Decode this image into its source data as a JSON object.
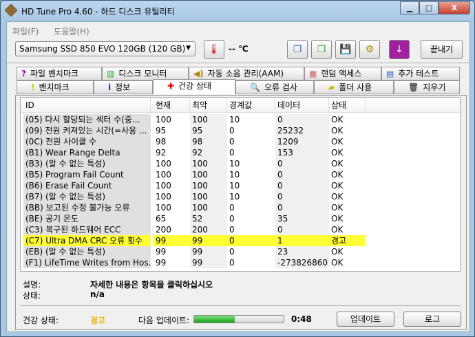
{
  "window": {
    "title": "HD Tune Pro 4.60 - 하드 디스크 유틸리티",
    "min": "▁",
    "max": "□",
    "close": "X"
  },
  "menu": [
    "파일(F)",
    "도움말(H)"
  ],
  "toolbar": {
    "drive": "Samsung SSD 850 EVO 120GB (120 GB)",
    "temperature": "-- ℃",
    "exit": "끝내기"
  },
  "tabs_row1": [
    "파일 벤치마크",
    "디스크 모니터",
    "자동 소음 관리(AAM)",
    "랜덤 액세스",
    "추가 테스트"
  ],
  "tabs_row2": [
    "벤치마크",
    "정보",
    "건강 상태",
    "오류 검사",
    "폴더 사용",
    "지우기"
  ],
  "table": {
    "headers": [
      "ID",
      "현재",
      "최악",
      "경계값",
      "데이터",
      "상태"
    ],
    "rows": [
      [
        "(05) 다시 할당되는 섹터 수(중...",
        "100",
        "100",
        "10",
        "0",
        "OK"
      ],
      [
        "(09) 전원 켜져있는 시간(=사용 ...",
        "95",
        "95",
        "0",
        "25232",
        "OK"
      ],
      [
        "(0C) 전원 사이클 수",
        "98",
        "98",
        "0",
        "1209",
        "OK"
      ],
      [
        "(B1) Wear Range Delta",
        "92",
        "92",
        "0",
        "153",
        "OK"
      ],
      [
        "(B3) (알 수 없는 특성)",
        "100",
        "100",
        "10",
        "0",
        "OK"
      ],
      [
        "(B5) Program Fail Count",
        "100",
        "100",
        "10",
        "0",
        "OK"
      ],
      [
        "(B6) Erase Fail Count",
        "100",
        "100",
        "10",
        "0",
        "OK"
      ],
      [
        "(B7) (알 수 없는 특성)",
        "100",
        "100",
        "10",
        "0",
        "OK"
      ],
      [
        "(BB) 보고된 수정 불가능 오류",
        "100",
        "100",
        "0",
        "0",
        "OK"
      ],
      [
        "(BE) 공기 온도",
        "65",
        "52",
        "0",
        "35",
        "OK"
      ],
      [
        "(C3) 복구된 하드웨어 ECC",
        "200",
        "200",
        "0",
        "0",
        "OK"
      ],
      [
        "(C7) Ultra DMA CRC 오류 횟수",
        "99",
        "99",
        "0",
        "1",
        "경고"
      ],
      [
        "(EB) (알 수 없는 특성)",
        "99",
        "99",
        "0",
        "23",
        "OK"
      ],
      [
        "(F1) LifeTime Writes from Hos...",
        "99",
        "99",
        "0",
        "-273826860",
        "OK"
      ]
    ],
    "warning_row": 11
  },
  "details": {
    "desc_label": "설명:",
    "desc_value": "자세한 내용은 항목을 클릭하십시오",
    "status_label": "상태:",
    "status_value": "n/a"
  },
  "footer": {
    "health_label": "건강 상태:",
    "health_value": "경고",
    "next_label": "다음 업데이트:",
    "progress_percent": 45,
    "countdown": "0:48",
    "update_button": "업데이트",
    "log_button": "로그"
  },
  "colors": {
    "warning_row": "#ffff33",
    "health_warning": "#f0b400"
  }
}
